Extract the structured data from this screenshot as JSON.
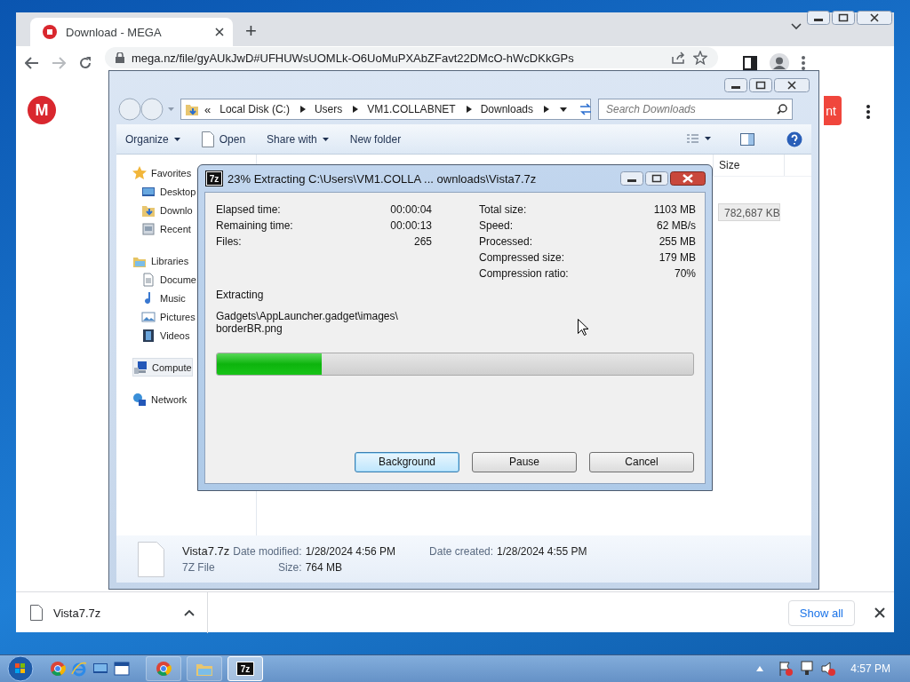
{
  "browser": {
    "tab": {
      "title": "Download - MEGA",
      "selected": true
    },
    "new_tab": "+",
    "url": "mega.nz/file/gyAUkJwD#UFHUWsUOMLk-O6UoMuPXAbZFavt22DMcO-hWcDKkGPs",
    "page": {
      "logo": "M",
      "button": "nt"
    },
    "download": {
      "file": "Vista7.7z"
    },
    "show_all": "Show all"
  },
  "explorer": {
    "breadcrumb_prefix": "«",
    "breadcrumb": [
      "Local Disk (C:)",
      "Users",
      "VM1.COLLABNET",
      "Downloads"
    ],
    "search": {
      "placeholder": "Search Downloads"
    },
    "commands": [
      {
        "kind": "menu",
        "label": "Organize"
      },
      {
        "kind": "open",
        "label": "Open"
      },
      {
        "kind": "menu",
        "label": "Share with"
      },
      {
        "kind": "plain",
        "label": "New folder"
      }
    ],
    "nav": [
      {
        "label": "Favorites",
        "kind": "star",
        "selected": false,
        "children": [
          {
            "label": "Desktop",
            "kind": "desktop",
            "selected": false
          },
          {
            "label": "Downlo",
            "kind": "download",
            "selected": false
          },
          {
            "label": "Recent",
            "kind": "recent",
            "selected": false
          }
        ]
      },
      {
        "label": "Libraries",
        "kind": "library",
        "selected": false,
        "children": [
          {
            "label": "Docume",
            "kind": "document",
            "selected": false
          },
          {
            "label": "Music",
            "kind": "music",
            "selected": false
          },
          {
            "label": "Pictures",
            "kind": "pictures",
            "selected": false
          },
          {
            "label": "Videos",
            "kind": "videos",
            "selected": false
          }
        ]
      },
      {
        "label": "Compute",
        "kind": "computer",
        "selected": true
      },
      {
        "label": "Network",
        "kind": "network",
        "selected": false
      }
    ],
    "columns": [
      "Size"
    ],
    "rows": [
      {
        "size": "782,687 KB",
        "selected": true
      }
    ],
    "details": {
      "name": "Vista7.7z",
      "type": "7Z File",
      "modified_label": "Date modified:",
      "modified": "1/28/2024 4:56 PM",
      "size_label": "Size:",
      "size": "764 MB",
      "created_label": "Date created:",
      "created": "1/28/2024 4:55 PM"
    }
  },
  "dialog": {
    "icon": "7z",
    "title": "23% Extracting C:\\Users\\VM1.COLLA ... ownloads\\Vista7.7z",
    "left": [
      {
        "label": "Elapsed time:",
        "value": "00:00:04"
      },
      {
        "label": "Remaining time:",
        "value": "00:00:13"
      },
      {
        "label": "Files:",
        "value": "265"
      }
    ],
    "right": [
      {
        "label": "Total size:",
        "value": "1103 MB"
      },
      {
        "label": "Speed:",
        "value": "62 MB/s"
      },
      {
        "label": "Processed:",
        "value": "255 MB"
      },
      {
        "label": "Compressed size:",
        "value": "179 MB"
      },
      {
        "label": "Compression ratio:",
        "value": "70%"
      }
    ],
    "status": "Extracting",
    "path": [
      "Gadgets\\AppLauncher.gadget\\images\\",
      "borderBR.png"
    ],
    "progress": {
      "level": 0.22
    },
    "buttons": [
      {
        "label": "Background",
        "selected": true
      },
      {
        "label": "Pause",
        "selected": false
      },
      {
        "label": "Cancel",
        "selected": false
      }
    ]
  },
  "taskbar": {
    "tasks": [
      {
        "kind": "browser",
        "selected": false
      },
      {
        "kind": "folder",
        "selected": false
      },
      {
        "kind": "archive",
        "label": "7z",
        "selected": true
      }
    ],
    "clock": "4:57 PM"
  }
}
